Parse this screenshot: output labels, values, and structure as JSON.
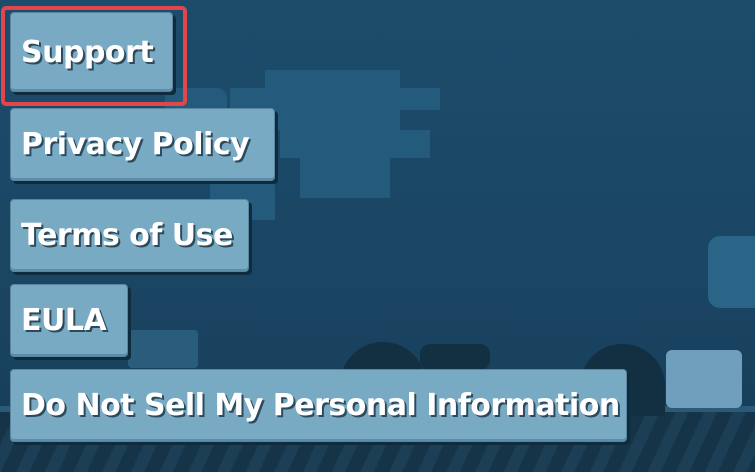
{
  "menu": {
    "items": [
      {
        "label": "Support",
        "selected": true
      },
      {
        "label": "Privacy Policy",
        "selected": false
      },
      {
        "label": "Terms of Use",
        "selected": false
      },
      {
        "label": "EULA",
        "selected": false
      },
      {
        "label": "Do Not Sell My Personal Information",
        "selected": false
      }
    ]
  },
  "colors": {
    "background": "#1c4a68",
    "button": "#78aac4",
    "button_text": "#ffffff",
    "selection_outline": "#e0474c"
  }
}
